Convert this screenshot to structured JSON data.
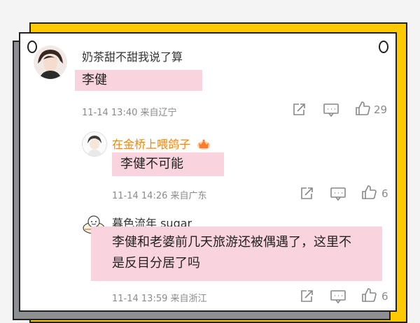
{
  "comments": [
    {
      "username": "奶茶甜不甜我说了算",
      "text": "李健",
      "time": "11-14 13:40",
      "location": "来自辽宁",
      "likes": "29"
    },
    {
      "username": "在金桥上喂鸽子",
      "text": "李健不可能",
      "time": "11-14 14:26",
      "location": "来自广东",
      "likes": "6",
      "badge_icon": "crown-badge-icon"
    },
    {
      "username": "暮色流年 sugar",
      "text_line1": "李健和老婆前几天旅游还被偶遇了，这里不",
      "text_line2": "是反目分居了吗",
      "time": "11-14 13:59",
      "location": "来自浙江",
      "likes": "6"
    }
  ],
  "colors": {
    "highlight": "#f9d3dd",
    "username_orange": "#ff8200",
    "frame_yellow": "#ffc900",
    "frame_gray": "#8e8f93"
  },
  "icons": [
    "share-icon",
    "comment-icon",
    "like-icon"
  ]
}
